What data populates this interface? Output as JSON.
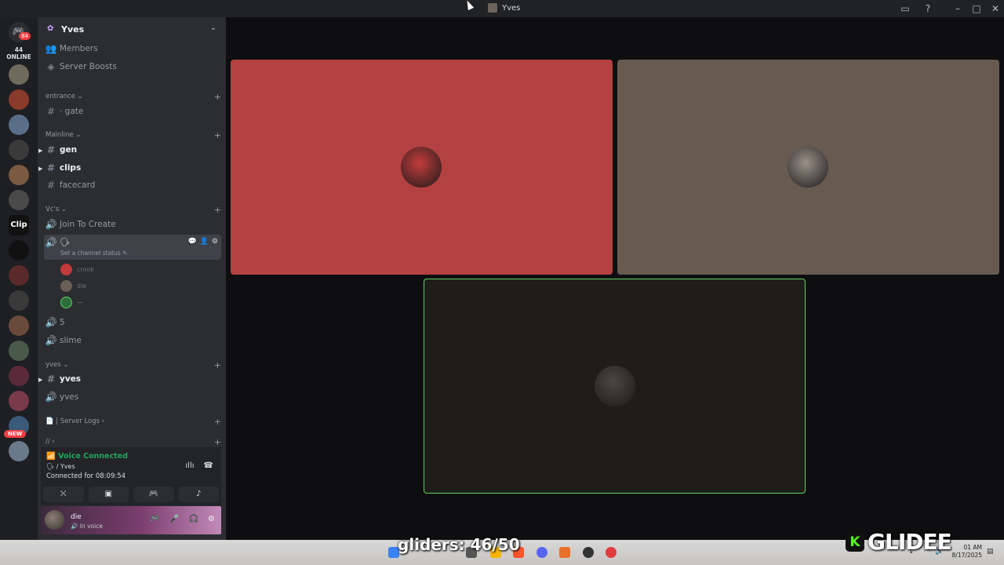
{
  "window": {
    "title": "Yves"
  },
  "rail": {
    "home_badge": "84",
    "online_count": "44 ONLINE",
    "clip_label": "Clip",
    "new_badge": "NEW",
    "servers": [
      {
        "color": "#6e6a5c"
      },
      {
        "color": "#8a3a2a"
      },
      {
        "color": "#5a6e8a"
      },
      {
        "color": "#3a3a3a"
      },
      {
        "color": "#7a5a40"
      },
      {
        "color": "#4a4a4a"
      },
      {
        "color": "#111111"
      },
      {
        "color": "#5a2a2a"
      },
      {
        "color": "#3a3a3a"
      },
      {
        "color": "#6a4a3a"
      },
      {
        "color": "#4a5a4a"
      },
      {
        "color": "#5a2a3a"
      },
      {
        "color": "#7a3a4a"
      },
      {
        "color": "#3a5a7a"
      },
      {
        "color": "#6a7a8a"
      }
    ]
  },
  "server": {
    "name": "Yves",
    "menu": [
      {
        "label": "Members",
        "icon": "members-icon"
      },
      {
        "label": "Server Boosts",
        "icon": "boost-icon"
      }
    ],
    "categories": {
      "entrance": "entrance",
      "mainline": "Mainline",
      "vcs": "Vc's",
      "yves": "yves",
      "server_logs": "| Server Logs",
      "slash": "//"
    },
    "channels": {
      "gate": "· gate",
      "gen": "gen",
      "clips": "clips",
      "facecard": "facecard",
      "join_to_create": "Join To Create",
      "voice_active": "🗣",
      "channel_status": "Set a channel status",
      "five": "5",
      "slime": "slime",
      "yves_text": "yves",
      "yves_voice": "yves"
    },
    "voice_members": [
      {
        "name": "crook",
        "color": "#c0393b"
      },
      {
        "name": "die",
        "color": "#6a5f56"
      },
      {
        "name": "—",
        "color": "#2c6e3a"
      }
    ]
  },
  "voice_panel": {
    "status": "Voice Connected",
    "location": "🗣 / Yves",
    "connected": "Connected for 08:09:54"
  },
  "user": {
    "name": "die",
    "status": "In voice"
  },
  "tiles": [
    {
      "bg": "#b34141",
      "avatar": "#c23c3c"
    },
    {
      "bg": "#675a4f",
      "avatar": "#9a9088"
    },
    {
      "bg": "#1f1d1a",
      "avatar": "#4a4744",
      "border": "#5fd164"
    }
  ],
  "overlay": {
    "gliders": "gliders: 46/50",
    "brand": "GLIDEE",
    "brand_letter": "K"
  },
  "taskbar": {
    "time": "01 AM",
    "date": "8/17/2025"
  }
}
